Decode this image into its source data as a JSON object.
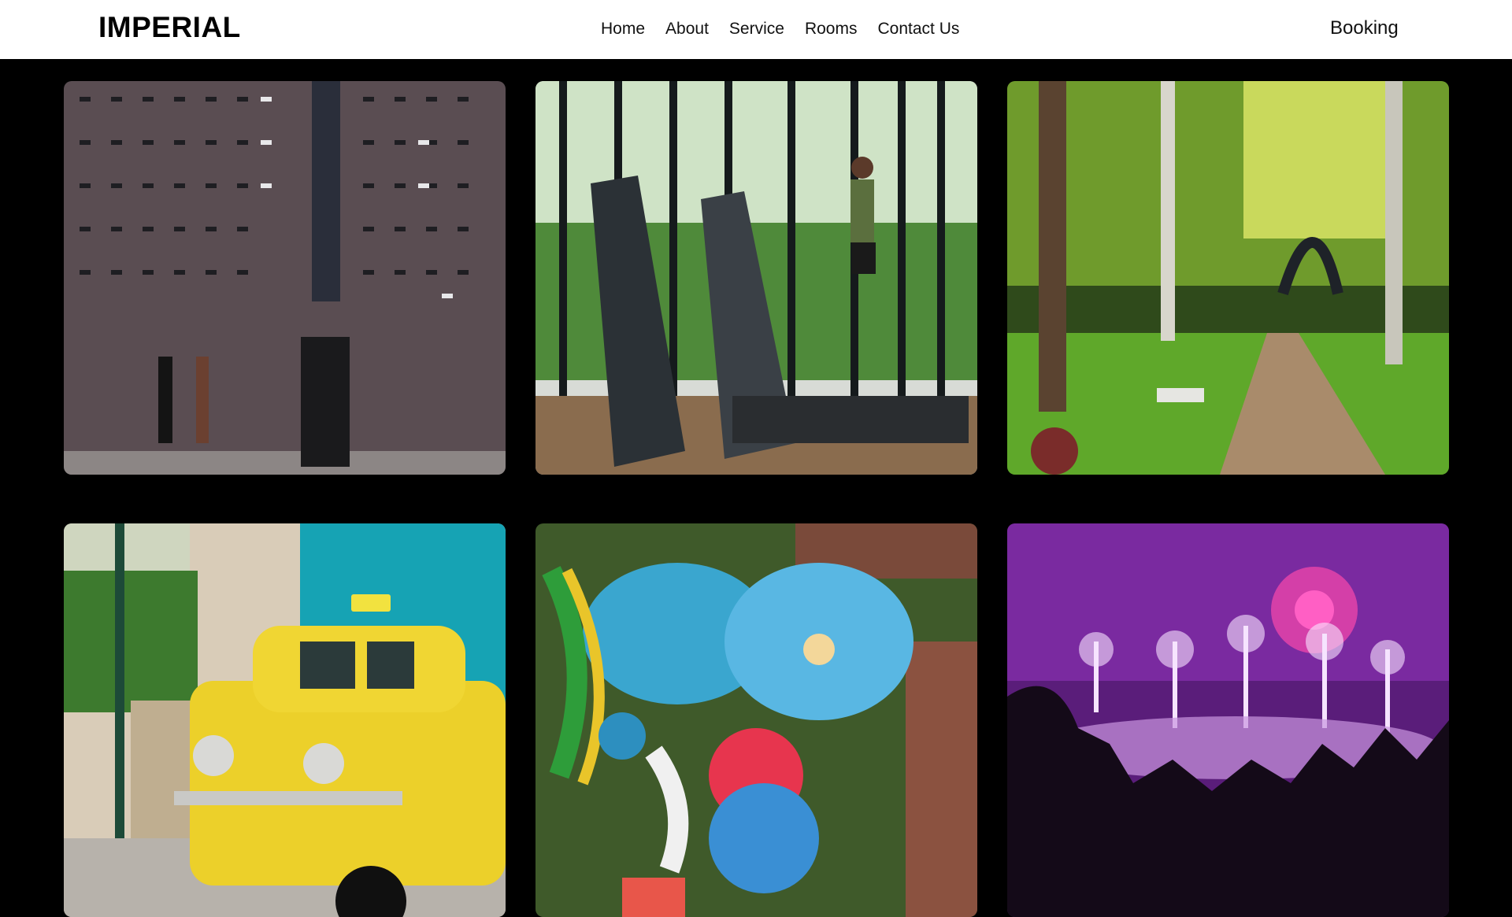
{
  "header": {
    "brand": "IMPERIAL",
    "nav": [
      "Home",
      "About",
      "Service",
      "Rooms",
      "Contact Us"
    ],
    "booking": "Booking"
  },
  "gallery": {
    "images": [
      {
        "subject": "cameras-wall"
      },
      {
        "subject": "gym-treadmills"
      },
      {
        "subject": "forest-park"
      },
      {
        "subject": "yellow-taxi"
      },
      {
        "subject": "waterpark-aerial"
      },
      {
        "subject": "concert-fireworks"
      }
    ]
  }
}
